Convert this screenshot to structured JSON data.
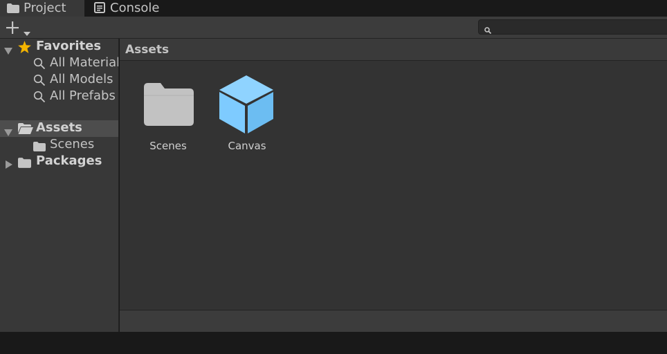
{
  "tabs": [
    {
      "label": "Project",
      "icon": "folder-icon",
      "active": true
    },
    {
      "label": "Console",
      "icon": "console-icon",
      "active": false
    }
  ],
  "toolbar": {
    "add_icon": "plus-icon",
    "dropdown_icon": "caret-down-icon",
    "search": {
      "value": "",
      "placeholder": ""
    }
  },
  "sidebar": {
    "favorites": {
      "label": "Favorites",
      "icon": "star-icon",
      "expanded": true,
      "items": [
        {
          "label": "All Material",
          "icon": "search-icon"
        },
        {
          "label": "All Models",
          "icon": "search-icon"
        },
        {
          "label": "All Prefabs",
          "icon": "search-icon"
        }
      ]
    },
    "assets": {
      "label": "Assets",
      "icon": "folder-open-icon",
      "expanded": true,
      "selected": true,
      "children": [
        {
          "label": "Scenes",
          "icon": "folder-icon"
        }
      ]
    },
    "packages": {
      "label": "Packages",
      "icon": "folder-icon",
      "expanded": false
    }
  },
  "main": {
    "title": "Assets",
    "items": [
      {
        "label": "Scenes",
        "icon": "folder-icon"
      },
      {
        "label": "Canvas",
        "icon": "prefab-cube-icon"
      }
    ]
  },
  "colors": {
    "accent_star": "#f4b400",
    "prefab_blue": "#7ecbff",
    "folder_gray": "#c2c2c2",
    "panel_bg": "#383838",
    "content_bg": "#333333",
    "selection_bg": "#4d4d4d"
  }
}
